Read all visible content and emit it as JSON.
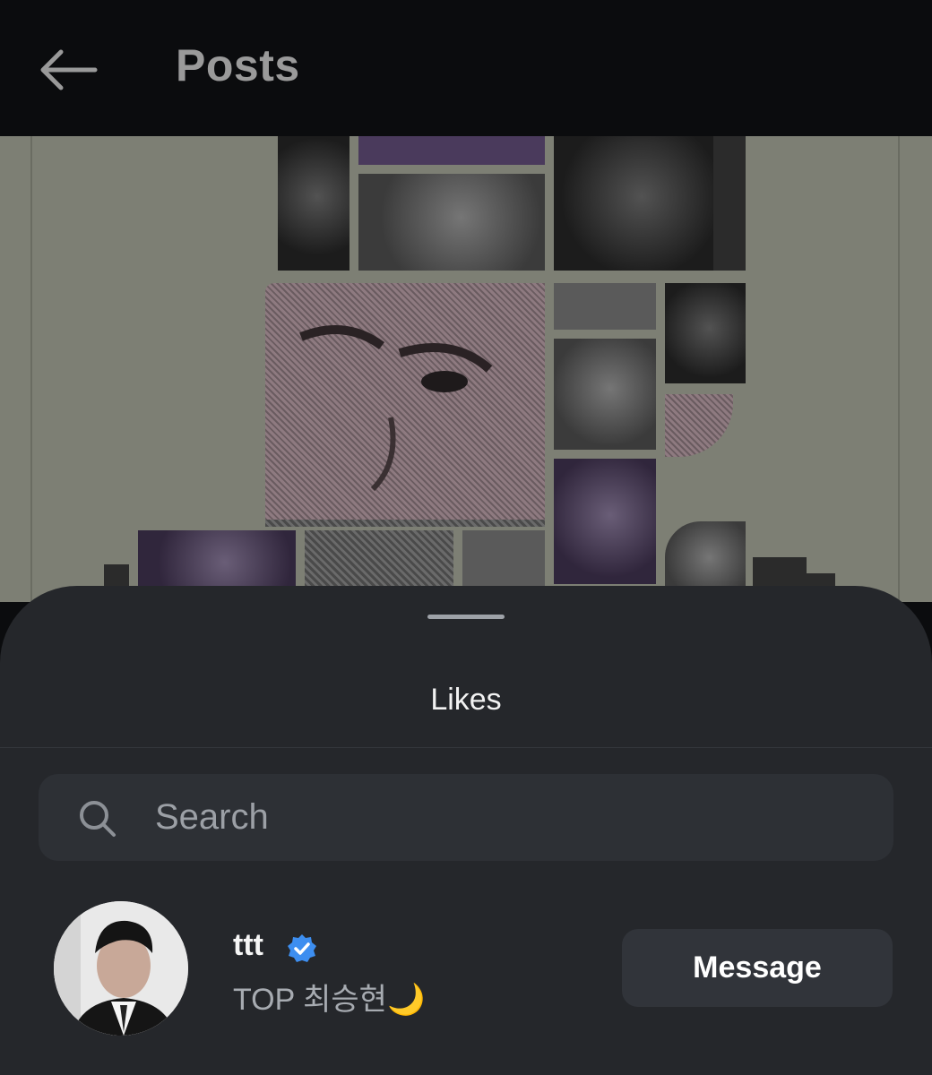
{
  "header": {
    "back_icon": "arrow-left-icon",
    "title": "Posts"
  },
  "post": {
    "description": "collage artwork"
  },
  "likes_sheet": {
    "title": "Likes",
    "search": {
      "placeholder": "Search",
      "icon": "search-icon"
    },
    "users": [
      {
        "username": "ttt",
        "verified": true,
        "display_name": "TOP 최승현🌙",
        "button_label": "Message"
      }
    ]
  },
  "colors": {
    "topbar_bg": "#0b0c0e",
    "sheet_bg": "#25272b",
    "search_bg": "#2d3035",
    "button_bg": "#31343a",
    "verified_blue": "#3d8ef0"
  }
}
